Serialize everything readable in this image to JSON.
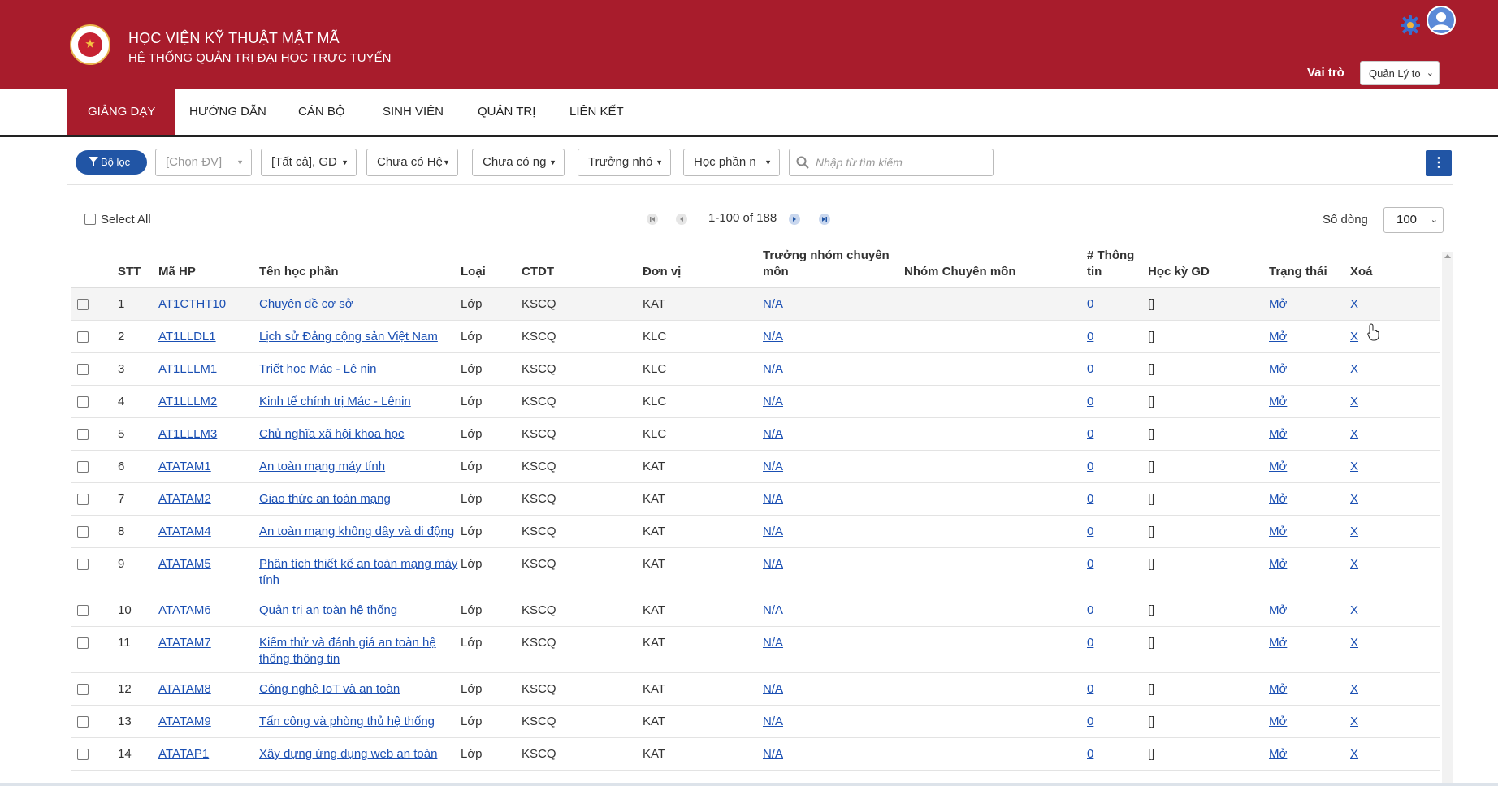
{
  "header": {
    "title": "HỌC VIỆN KỸ THUẬT MẬT MÃ",
    "subtitle": "HỆ THỐNG QUẢN TRỊ ĐẠI HỌC TRỰC TUYẾN",
    "role_label": "Vai trò",
    "role_value": "Quản Lý to",
    "colors": {
      "brand": "#a81c2c",
      "accent": "#2155a5",
      "link": "#1a4fb3"
    }
  },
  "nav": {
    "items": [
      {
        "label": "GIẢNG DẠY",
        "active": true
      },
      {
        "label": "HƯỚNG DẪN"
      },
      {
        "label": "CÁN BỘ"
      },
      {
        "label": "SINH VIÊN"
      },
      {
        "label": "QUẢN TRỊ"
      },
      {
        "label": "LIÊN KẾT"
      }
    ]
  },
  "filters": {
    "filter_button": "Bộ lọc",
    "unit": "[Chọn ĐV]",
    "all_gd": "[Tất cả], GD",
    "system": "Chưa có Hệ",
    "industry": "Chưa có ng",
    "group_lead": "Trưởng nhó",
    "course": "Học phần n",
    "search_placeholder": "Nhập từ tìm kiếm"
  },
  "pagination": {
    "select_all": "Select All",
    "range": "1-100 of 188",
    "rows_label": "Số dòng",
    "rows_value": "100"
  },
  "table": {
    "headers": {
      "stt": "STT",
      "code": "Mã HP",
      "name": "Tên học phần",
      "type": "Loại",
      "ctdt": "CTDT",
      "unit": "Đơn vị",
      "lead": "Trưởng nhóm chuyên môn",
      "group": "Nhóm Chuyên môn",
      "info": "# Thông tin",
      "semester": "Học kỳ GD",
      "status": "Trạng thái",
      "delete": "Xoá"
    },
    "rows": [
      {
        "stt": "1",
        "code": "AT1CTHT10",
        "name": "Chuyên đề cơ sở",
        "type": "Lớp",
        "ctdt": "KSCQ",
        "unit": "KAT",
        "lead": "N/A",
        "group": "",
        "info": "0",
        "semester": "[]",
        "status": "Mở",
        "delete": "X"
      },
      {
        "stt": "2",
        "code": "AT1LLDL1",
        "name": "Lịch sử Đảng cộng sản Việt Nam",
        "type": "Lớp",
        "ctdt": "KSCQ",
        "unit": "KLC",
        "lead": "N/A",
        "group": "",
        "info": "0",
        "semester": "[]",
        "status": "Mở",
        "delete": "X"
      },
      {
        "stt": "3",
        "code": "AT1LLLM1",
        "name": "Triết học Mác - Lê nin",
        "type": "Lớp",
        "ctdt": "KSCQ",
        "unit": "KLC",
        "lead": "N/A",
        "group": "",
        "info": "0",
        "semester": "[]",
        "status": "Mở",
        "delete": "X"
      },
      {
        "stt": "4",
        "code": "AT1LLLM2",
        "name": "Kinh tế chính trị Mác - Lênin",
        "type": "Lớp",
        "ctdt": "KSCQ",
        "unit": "KLC",
        "lead": "N/A",
        "group": "",
        "info": "0",
        "semester": "[]",
        "status": "Mở",
        "delete": "X"
      },
      {
        "stt": "5",
        "code": "AT1LLLM3",
        "name": "Chủ nghĩa xã hội khoa học",
        "type": "Lớp",
        "ctdt": "KSCQ",
        "unit": "KLC",
        "lead": "N/A",
        "group": "",
        "info": "0",
        "semester": "[]",
        "status": "Mở",
        "delete": "X"
      },
      {
        "stt": "6",
        "code": "ATATAM1",
        "name": "An toàn mạng máy tính",
        "type": "Lớp",
        "ctdt": "KSCQ",
        "unit": "KAT",
        "lead": "N/A",
        "group": "",
        "info": "0",
        "semester": "[]",
        "status": "Mở",
        "delete": "X"
      },
      {
        "stt": "7",
        "code": "ATATAM2",
        "name": "Giao thức an toàn mạng",
        "type": "Lớp",
        "ctdt": "KSCQ",
        "unit": "KAT",
        "lead": "N/A",
        "group": "",
        "info": "0",
        "semester": "[]",
        "status": "Mở",
        "delete": "X"
      },
      {
        "stt": "8",
        "code": "ATATAM4",
        "name": "An toàn mạng không dây và di động",
        "type": "Lớp",
        "ctdt": "KSCQ",
        "unit": "KAT",
        "lead": "N/A",
        "group": "",
        "info": "0",
        "semester": "[]",
        "status": "Mở",
        "delete": "X"
      },
      {
        "stt": "9",
        "code": "ATATAM5",
        "name": "Phân tích thiết kế an toàn mạng máy tính",
        "type": "Lớp",
        "ctdt": "KSCQ",
        "unit": "KAT",
        "lead": "N/A",
        "group": "",
        "info": "0",
        "semester": "[]",
        "status": "Mở",
        "delete": "X"
      },
      {
        "stt": "10",
        "code": "ATATAM6",
        "name": "Quản trị an toàn hệ thống",
        "type": "Lớp",
        "ctdt": "KSCQ",
        "unit": "KAT",
        "lead": "N/A",
        "group": "",
        "info": "0",
        "semester": "[]",
        "status": "Mở",
        "delete": "X"
      },
      {
        "stt": "11",
        "code": "ATATAM7",
        "name": "Kiểm thử và đánh giá an toàn hệ thống thông tin",
        "type": "Lớp",
        "ctdt": "KSCQ",
        "unit": "KAT",
        "lead": "N/A",
        "group": "",
        "info": "0",
        "semester": "[]",
        "status": "Mở",
        "delete": "X"
      },
      {
        "stt": "12",
        "code": "ATATAM8",
        "name": "Công nghệ IoT và an toàn",
        "type": "Lớp",
        "ctdt": "KSCQ",
        "unit": "KAT",
        "lead": "N/A",
        "group": "",
        "info": "0",
        "semester": "[]",
        "status": "Mở",
        "delete": "X"
      },
      {
        "stt": "13",
        "code": "ATATAM9",
        "name": "Tấn công và phòng thủ hệ thống",
        "type": "Lớp",
        "ctdt": "KSCQ",
        "unit": "KAT",
        "lead": "N/A",
        "group": "",
        "info": "0",
        "semester": "[]",
        "status": "Mở",
        "delete": "X"
      },
      {
        "stt": "14",
        "code": "ATATAP1",
        "name": "Xây dựng ứng dụng web an toàn",
        "type": "Lớp",
        "ctdt": "KSCQ",
        "unit": "KAT",
        "lead": "N/A",
        "group": "",
        "info": "0",
        "semester": "[]",
        "status": "Mở",
        "delete": "X"
      }
    ]
  }
}
